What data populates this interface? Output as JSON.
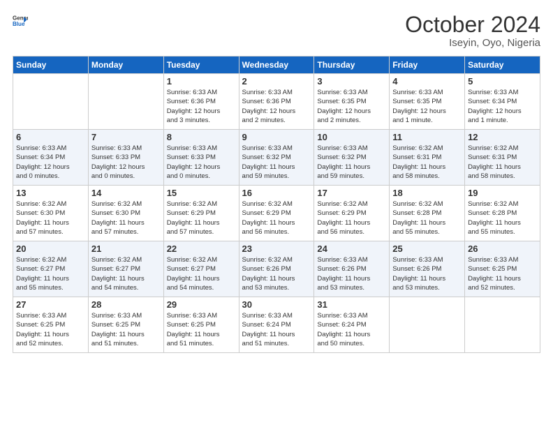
{
  "header": {
    "logo_line1": "General",
    "logo_line2": "Blue",
    "title": "October 2024",
    "subtitle": "Iseyin, Oyo, Nigeria"
  },
  "days_of_week": [
    "Sunday",
    "Monday",
    "Tuesday",
    "Wednesday",
    "Thursday",
    "Friday",
    "Saturday"
  ],
  "weeks": [
    [
      {
        "day": "",
        "info": ""
      },
      {
        "day": "",
        "info": ""
      },
      {
        "day": "1",
        "info": "Sunrise: 6:33 AM\nSunset: 6:36 PM\nDaylight: 12 hours\nand 3 minutes."
      },
      {
        "day": "2",
        "info": "Sunrise: 6:33 AM\nSunset: 6:36 PM\nDaylight: 12 hours\nand 2 minutes."
      },
      {
        "day": "3",
        "info": "Sunrise: 6:33 AM\nSunset: 6:35 PM\nDaylight: 12 hours\nand 2 minutes."
      },
      {
        "day": "4",
        "info": "Sunrise: 6:33 AM\nSunset: 6:35 PM\nDaylight: 12 hours\nand 1 minute."
      },
      {
        "day": "5",
        "info": "Sunrise: 6:33 AM\nSunset: 6:34 PM\nDaylight: 12 hours\nand 1 minute."
      }
    ],
    [
      {
        "day": "6",
        "info": "Sunrise: 6:33 AM\nSunset: 6:34 PM\nDaylight: 12 hours\nand 0 minutes."
      },
      {
        "day": "7",
        "info": "Sunrise: 6:33 AM\nSunset: 6:33 PM\nDaylight: 12 hours\nand 0 minutes."
      },
      {
        "day": "8",
        "info": "Sunrise: 6:33 AM\nSunset: 6:33 PM\nDaylight: 12 hours\nand 0 minutes."
      },
      {
        "day": "9",
        "info": "Sunrise: 6:33 AM\nSunset: 6:32 PM\nDaylight: 11 hours\nand 59 minutes."
      },
      {
        "day": "10",
        "info": "Sunrise: 6:33 AM\nSunset: 6:32 PM\nDaylight: 11 hours\nand 59 minutes."
      },
      {
        "day": "11",
        "info": "Sunrise: 6:32 AM\nSunset: 6:31 PM\nDaylight: 11 hours\nand 58 minutes."
      },
      {
        "day": "12",
        "info": "Sunrise: 6:32 AM\nSunset: 6:31 PM\nDaylight: 11 hours\nand 58 minutes."
      }
    ],
    [
      {
        "day": "13",
        "info": "Sunrise: 6:32 AM\nSunset: 6:30 PM\nDaylight: 11 hours\nand 57 minutes."
      },
      {
        "day": "14",
        "info": "Sunrise: 6:32 AM\nSunset: 6:30 PM\nDaylight: 11 hours\nand 57 minutes."
      },
      {
        "day": "15",
        "info": "Sunrise: 6:32 AM\nSunset: 6:29 PM\nDaylight: 11 hours\nand 57 minutes."
      },
      {
        "day": "16",
        "info": "Sunrise: 6:32 AM\nSunset: 6:29 PM\nDaylight: 11 hours\nand 56 minutes."
      },
      {
        "day": "17",
        "info": "Sunrise: 6:32 AM\nSunset: 6:29 PM\nDaylight: 11 hours\nand 56 minutes."
      },
      {
        "day": "18",
        "info": "Sunrise: 6:32 AM\nSunset: 6:28 PM\nDaylight: 11 hours\nand 55 minutes."
      },
      {
        "day": "19",
        "info": "Sunrise: 6:32 AM\nSunset: 6:28 PM\nDaylight: 11 hours\nand 55 minutes."
      }
    ],
    [
      {
        "day": "20",
        "info": "Sunrise: 6:32 AM\nSunset: 6:27 PM\nDaylight: 11 hours\nand 55 minutes."
      },
      {
        "day": "21",
        "info": "Sunrise: 6:32 AM\nSunset: 6:27 PM\nDaylight: 11 hours\nand 54 minutes."
      },
      {
        "day": "22",
        "info": "Sunrise: 6:32 AM\nSunset: 6:27 PM\nDaylight: 11 hours\nand 54 minutes."
      },
      {
        "day": "23",
        "info": "Sunrise: 6:32 AM\nSunset: 6:26 PM\nDaylight: 11 hours\nand 53 minutes."
      },
      {
        "day": "24",
        "info": "Sunrise: 6:33 AM\nSunset: 6:26 PM\nDaylight: 11 hours\nand 53 minutes."
      },
      {
        "day": "25",
        "info": "Sunrise: 6:33 AM\nSunset: 6:26 PM\nDaylight: 11 hours\nand 53 minutes."
      },
      {
        "day": "26",
        "info": "Sunrise: 6:33 AM\nSunset: 6:25 PM\nDaylight: 11 hours\nand 52 minutes."
      }
    ],
    [
      {
        "day": "27",
        "info": "Sunrise: 6:33 AM\nSunset: 6:25 PM\nDaylight: 11 hours\nand 52 minutes."
      },
      {
        "day": "28",
        "info": "Sunrise: 6:33 AM\nSunset: 6:25 PM\nDaylight: 11 hours\nand 51 minutes."
      },
      {
        "day": "29",
        "info": "Sunrise: 6:33 AM\nSunset: 6:25 PM\nDaylight: 11 hours\nand 51 minutes."
      },
      {
        "day": "30",
        "info": "Sunrise: 6:33 AM\nSunset: 6:24 PM\nDaylight: 11 hours\nand 51 minutes."
      },
      {
        "day": "31",
        "info": "Sunrise: 6:33 AM\nSunset: 6:24 PM\nDaylight: 11 hours\nand 50 minutes."
      },
      {
        "day": "",
        "info": ""
      },
      {
        "day": "",
        "info": ""
      }
    ]
  ]
}
